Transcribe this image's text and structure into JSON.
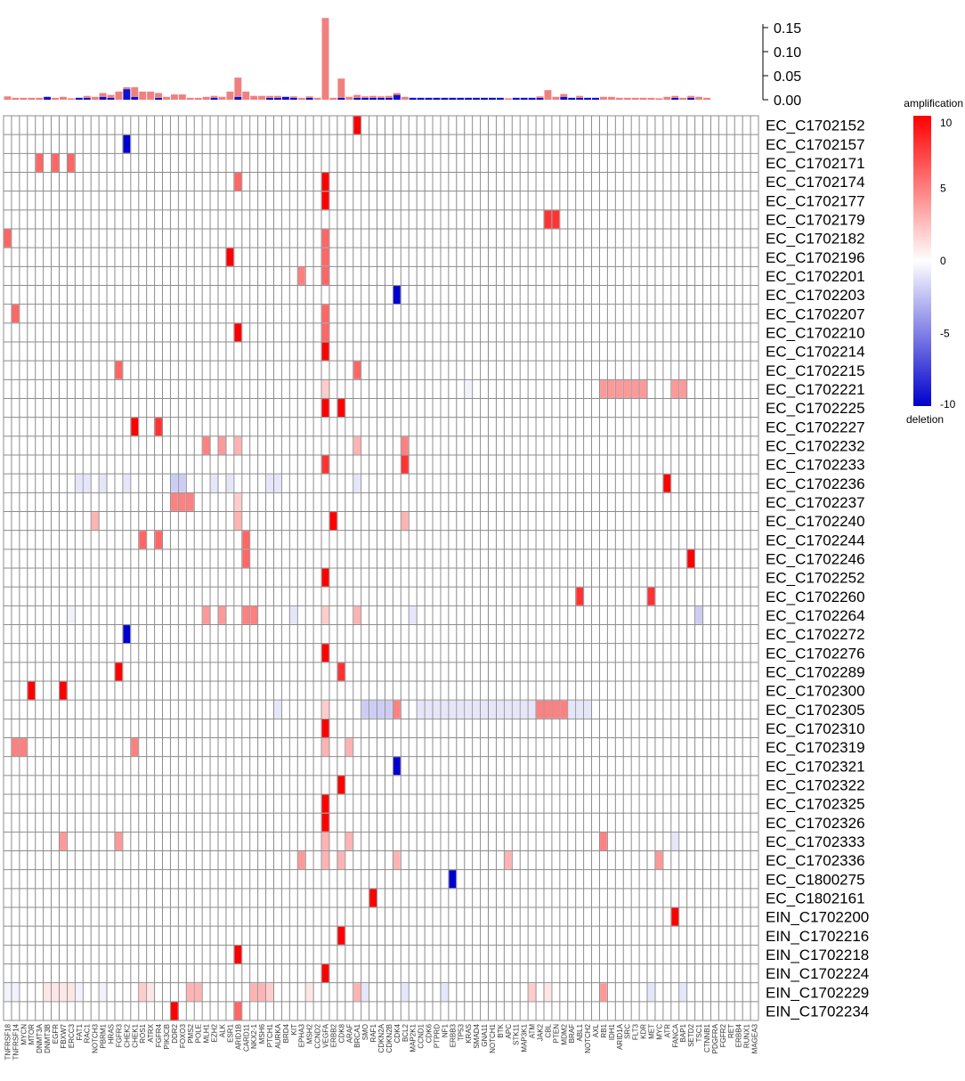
{
  "chart_data": {
    "type": "heatmap",
    "title": "",
    "colors": {
      "amplification": "#ff0000",
      "deletion": "#0000cc",
      "neutral": "#ffffff",
      "grid": "#8c8c8c",
      "bar_amplification": "#f08080",
      "bar_deletion": "#1010d0",
      "highlight_label": "#e53935"
    },
    "legend": {
      "top_label": "amplification",
      "bottom_label": "deletion",
      "placement": "top-right",
      "range": [
        -10,
        10
      ],
      "ticks": [
        "10",
        "5",
        "0",
        "-5",
        "-10"
      ]
    },
    "bar_axis": {
      "ylim": [
        0,
        0.2
      ],
      "ticks": [
        "0.15",
        "0.10",
        "0.05",
        "0.00"
      ]
    },
    "columns": [
      "TNFRSF18",
      "TNFRSF14",
      "MYCN",
      "MTOR",
      "DNMT3A",
      "DNMT3B",
      "EGFR",
      "FBXW7",
      "ERCC3",
      "FAT1",
      "RAC1",
      "NOTCH3",
      "PBRM1",
      "HRAS",
      "FGFR3",
      "CHEK2",
      "CHEK1",
      "ROS1",
      "ATRX",
      "FGFR4",
      "PIK3CB",
      "DDR2",
      "FOXO3",
      "PMS2",
      "POLE",
      "MLH1",
      "EZH2",
      "ALK",
      "ESR1",
      "ARID1B",
      "CARD11",
      "NKX2-1",
      "MSH6",
      "PTCH1",
      "AURKA",
      "BRD4",
      "KIT",
      "EPHA3",
      "MSH2",
      "CCND2",
      "VEGFA",
      "ERBB2",
      "CDK8",
      "ARAF",
      "BRCA1",
      "SMO",
      "RAF1",
      "CDKN2A",
      "CDKN2B",
      "CDK4",
      "BCL2",
      "MAP2K1",
      "CCND1",
      "CDK6",
      "PTPRD",
      "NF1",
      "ERBB3",
      "TP53",
      "KRAS",
      "SMAD4",
      "GNA11",
      "NOTCH1",
      "BTK",
      "APC",
      "STK11",
      "MAP3K1",
      "ATM",
      "JAK2",
      "CBL",
      "PTEN",
      "MDM2",
      "BRAF",
      "ABL1",
      "NOTCH2",
      "AXL",
      "RB1",
      "IDH1",
      "ARID1A",
      "SRC",
      "FLT3",
      "KDR",
      "MET",
      "MYC",
      "ATR",
      "FANCA",
      "BAP1",
      "SETD2",
      "TSC1",
      "CTNNB1",
      "PDGFRA",
      "FGFR2",
      "RET",
      "ERBB4",
      "RUNX1",
      "MAGEA3"
    ],
    "highlight_column": 40,
    "rows": [
      "EC_C1702152",
      "EC_C1702157",
      "EC_C1702171",
      "EC_C1702174",
      "EC_C1702177",
      "EC_C1702179",
      "EC_C1702182",
      "EC_C1702196",
      "EC_C1702201",
      "EC_C1702203",
      "EC_C1702207",
      "EC_C1702210",
      "EC_C1702214",
      "EC_C1702215",
      "EC_C1702221",
      "EC_C1702225",
      "EC_C1702227",
      "EC_C1702232",
      "EC_C1702233",
      "EC_C1702236",
      "EC_C1702237",
      "EC_C1702240",
      "EC_C1702244",
      "EC_C1702246",
      "EC_C1702252",
      "EC_C1702260",
      "EC_C1702264",
      "EC_C1702272",
      "EC_C1702276",
      "EC_C1702289",
      "EC_C1702300",
      "EC_C1702305",
      "EC_C1702310",
      "EC_C1702319",
      "EC_C1702321",
      "EC_C1702322",
      "EC_C1702325",
      "EC_C1702326",
      "EC_C1702333",
      "EC_C1702336",
      "EC_C1800275",
      "EC_C1802161",
      "EIN_C1702200",
      "EIN_C1702216",
      "EIN_C1702218",
      "EIN_C1702224",
      "EIN_C1702229",
      "EIN_C1702234"
    ],
    "cells": [
      [
        0,
        44,
        10
      ],
      [
        1,
        15,
        -10
      ],
      [
        2,
        4,
        6
      ],
      [
        2,
        6,
        6
      ],
      [
        2,
        8,
        6
      ],
      [
        3,
        29,
        6
      ],
      [
        3,
        40,
        10
      ],
      [
        4,
        40,
        10
      ],
      [
        5,
        68,
        8
      ],
      [
        5,
        69,
        8
      ],
      [
        6,
        0,
        6
      ],
      [
        6,
        40,
        6
      ],
      [
        7,
        28,
        10
      ],
      [
        7,
        40,
        6
      ],
      [
        8,
        37,
        5
      ],
      [
        8,
        40,
        6
      ],
      [
        9,
        49,
        -10
      ],
      [
        10,
        1,
        6
      ],
      [
        10,
        40,
        6
      ],
      [
        11,
        29,
        10
      ],
      [
        11,
        40,
        6
      ],
      [
        12,
        40,
        10
      ],
      [
        13,
        14,
        6
      ],
      [
        13,
        44,
        6
      ],
      [
        14,
        40,
        2
      ],
      [
        14,
        58,
        -0.5
      ],
      [
        14,
        75,
        4
      ],
      [
        14,
        76,
        4
      ],
      [
        14,
        77,
        4
      ],
      [
        14,
        78,
        4
      ],
      [
        14,
        79,
        4
      ],
      [
        14,
        80,
        4
      ],
      [
        14,
        84,
        4
      ],
      [
        14,
        85,
        4
      ],
      [
        15,
        40,
        10
      ],
      [
        15,
        42,
        10
      ],
      [
        16,
        16,
        10
      ],
      [
        16,
        19,
        8
      ],
      [
        17,
        25,
        5
      ],
      [
        17,
        27,
        4
      ],
      [
        17,
        29,
        3
      ],
      [
        17,
        44,
        3
      ],
      [
        17,
        50,
        5
      ],
      [
        18,
        40,
        8
      ],
      [
        18,
        50,
        8
      ],
      [
        19,
        9,
        -1
      ],
      [
        19,
        10,
        -1
      ],
      [
        19,
        12,
        -1
      ],
      [
        19,
        15,
        -1
      ],
      [
        19,
        21,
        -2
      ],
      [
        19,
        22,
        -2
      ],
      [
        19,
        26,
        -1
      ],
      [
        19,
        28,
        -1
      ],
      [
        19,
        33,
        -1
      ],
      [
        19,
        34,
        -1
      ],
      [
        19,
        44,
        -1
      ],
      [
        19,
        83,
        10
      ],
      [
        20,
        21,
        5
      ],
      [
        20,
        22,
        5
      ],
      [
        20,
        23,
        5
      ],
      [
        20,
        29,
        2
      ],
      [
        21,
        11,
        3
      ],
      [
        21,
        29,
        3
      ],
      [
        21,
        41,
        10
      ],
      [
        21,
        50,
        3
      ],
      [
        22,
        17,
        6
      ],
      [
        22,
        19,
        6
      ],
      [
        22,
        30,
        6
      ],
      [
        23,
        30,
        6
      ],
      [
        23,
        86,
        10
      ],
      [
        24,
        40,
        10
      ],
      [
        25,
        72,
        8
      ],
      [
        25,
        81,
        8
      ],
      [
        26,
        8,
        -0.5
      ],
      [
        26,
        25,
        4
      ],
      [
        26,
        27,
        4
      ],
      [
        26,
        30,
        5
      ],
      [
        26,
        31,
        5
      ],
      [
        26,
        36,
        -1
      ],
      [
        26,
        40,
        2
      ],
      [
        26,
        44,
        3
      ],
      [
        26,
        51,
        -1
      ],
      [
        26,
        87,
        -2
      ],
      [
        27,
        15,
        -10
      ],
      [
        28,
        40,
        10
      ],
      [
        29,
        14,
        10
      ],
      [
        29,
        42,
        8
      ],
      [
        30,
        3,
        10
      ],
      [
        30,
        7,
        10
      ],
      [
        31,
        34,
        -1
      ],
      [
        31,
        40,
        2
      ],
      [
        31,
        45,
        -2
      ],
      [
        31,
        46,
        -2
      ],
      [
        31,
        47,
        -2
      ],
      [
        31,
        48,
        -2
      ],
      [
        31,
        49,
        5
      ],
      [
        31,
        52,
        -1
      ],
      [
        31,
        53,
        -1
      ],
      [
        31,
        54,
        -1
      ],
      [
        31,
        55,
        -1
      ],
      [
        31,
        56,
        -1
      ],
      [
        31,
        57,
        -1
      ],
      [
        31,
        58,
        -1
      ],
      [
        31,
        59,
        -1
      ],
      [
        31,
        60,
        -1
      ],
      [
        31,
        61,
        -1
      ],
      [
        31,
        62,
        -1
      ],
      [
        31,
        63,
        -1
      ],
      [
        31,
        64,
        -1
      ],
      [
        31,
        65,
        -1
      ],
      [
        31,
        66,
        -1
      ],
      [
        31,
        67,
        5
      ],
      [
        31,
        68,
        5
      ],
      [
        31,
        69,
        5
      ],
      [
        31,
        70,
        5
      ],
      [
        31,
        71,
        -1
      ],
      [
        31,
        72,
        -1
      ],
      [
        31,
        73,
        -1
      ],
      [
        32,
        40,
        10
      ],
      [
        33,
        1,
        5
      ],
      [
        33,
        2,
        5
      ],
      [
        33,
        16,
        5
      ],
      [
        33,
        40,
        3
      ],
      [
        33,
        43,
        3
      ],
      [
        34,
        49,
        -10
      ],
      [
        35,
        42,
        10
      ],
      [
        36,
        40,
        10
      ],
      [
        37,
        40,
        10
      ],
      [
        38,
        7,
        4
      ],
      [
        38,
        14,
        4
      ],
      [
        38,
        40,
        3
      ],
      [
        38,
        43,
        3
      ],
      [
        38,
        75,
        5
      ],
      [
        38,
        84,
        -1
      ],
      [
        39,
        37,
        4
      ],
      [
        39,
        40,
        3
      ],
      [
        39,
        42,
        3
      ],
      [
        39,
        49,
        3
      ],
      [
        39,
        63,
        3
      ],
      [
        39,
        82,
        4
      ],
      [
        40,
        56,
        -10
      ],
      [
        41,
        46,
        10
      ],
      [
        42,
        84,
        10
      ],
      [
        43,
        42,
        10
      ],
      [
        44,
        29,
        10
      ],
      [
        45,
        40,
        10
      ],
      [
        46,
        0,
        -0.5
      ],
      [
        46,
        1,
        -0.5
      ],
      [
        46,
        5,
        1
      ],
      [
        46,
        6,
        1
      ],
      [
        46,
        7,
        1
      ],
      [
        46,
        8,
        1
      ],
      [
        46,
        9,
        -0.5
      ],
      [
        46,
        12,
        -0.5
      ],
      [
        46,
        17,
        2
      ],
      [
        46,
        18,
        1
      ],
      [
        46,
        23,
        3
      ],
      [
        46,
        24,
        3
      ],
      [
        46,
        31,
        3
      ],
      [
        46,
        32,
        3
      ],
      [
        46,
        33,
        2
      ],
      [
        46,
        38,
        1
      ],
      [
        46,
        44,
        3
      ],
      [
        46,
        45,
        -1
      ],
      [
        46,
        50,
        -1
      ],
      [
        46,
        55,
        -1
      ],
      [
        46,
        66,
        2
      ],
      [
        46,
        68,
        1
      ],
      [
        46,
        75,
        4
      ],
      [
        46,
        81,
        -1
      ],
      [
        46,
        85,
        -1
      ],
      [
        47,
        21,
        10
      ],
      [
        47,
        29,
        6
      ]
    ],
    "column_bars": [
      {
        "amp": 0.007,
        "del": 0.0
      },
      {
        "amp": 0.004,
        "del": 0.0
      },
      {
        "amp": 0.004,
        "del": 0.0
      },
      {
        "amp": 0.004,
        "del": 0.0
      },
      {
        "amp": 0.004,
        "del": 0.0
      },
      {
        "amp": 0.0,
        "del": 0.006
      },
      {
        "amp": 0.004,
        "del": 0.0
      },
      {
        "amp": 0.006,
        "del": 0.0
      },
      {
        "amp": 0.003,
        "del": 0.0
      },
      {
        "amp": 0.0,
        "del": 0.004
      },
      {
        "amp": 0.004,
        "del": 0.004
      },
      {
        "amp": 0.006,
        "del": 0.0
      },
      {
        "amp": 0.008,
        "del": 0.006
      },
      {
        "amp": 0.006,
        "del": 0.004
      },
      {
        "amp": 0.017,
        "del": 0.0
      },
      {
        "amp": 0.004,
        "del": 0.022
      },
      {
        "amp": 0.02,
        "del": 0.006
      },
      {
        "amp": 0.017,
        "del": 0.0
      },
      {
        "amp": 0.017,
        "del": 0.0
      },
      {
        "amp": 0.01,
        "del": 0.004
      },
      {
        "amp": 0.006,
        "del": 0.0
      },
      {
        "amp": 0.011,
        "del": 0.0
      },
      {
        "amp": 0.011,
        "del": 0.0
      },
      {
        "amp": 0.004,
        "del": 0.0
      },
      {
        "amp": 0.004,
        "del": 0.0
      },
      {
        "amp": 0.006,
        "del": 0.0
      },
      {
        "amp": 0.004,
        "del": 0.004
      },
      {
        "amp": 0.006,
        "del": 0.0
      },
      {
        "amp": 0.017,
        "del": 0.0
      },
      {
        "amp": 0.04,
        "del": 0.006
      },
      {
        "amp": 0.017,
        "del": 0.0
      },
      {
        "amp": 0.008,
        "del": 0.0
      },
      {
        "amp": 0.008,
        "del": 0.0
      },
      {
        "amp": 0.004,
        "del": 0.004
      },
      {
        "amp": 0.004,
        "del": 0.004
      },
      {
        "amp": 0.0,
        "del": 0.006
      },
      {
        "amp": 0.003,
        "del": 0.004
      },
      {
        "amp": 0.004,
        "del": 0.0
      },
      {
        "amp": 0.003,
        "del": 0.004
      },
      {
        "amp": 0.004,
        "del": 0.0
      },
      {
        "amp": 0.17,
        "del": 0.0
      },
      {
        "amp": 0.004,
        "del": 0.0
      },
      {
        "amp": 0.04,
        "del": 0.004
      },
      {
        "amp": 0.006,
        "del": 0.0
      },
      {
        "amp": 0.006,
        "del": 0.004
      },
      {
        "amp": 0.003,
        "del": 0.004
      },
      {
        "amp": 0.004,
        "del": 0.004
      },
      {
        "amp": 0.003,
        "del": 0.004
      },
      {
        "amp": 0.004,
        "del": 0.004
      },
      {
        "amp": 0.004,
        "del": 0.01
      },
      {
        "amp": 0.006,
        "del": 0.0
      },
      {
        "amp": 0.0,
        "del": 0.004
      },
      {
        "amp": 0.0,
        "del": 0.004
      },
      {
        "amp": 0.0,
        "del": 0.004
      },
      {
        "amp": 0.0,
        "del": 0.004
      },
      {
        "amp": 0.0,
        "del": 0.004
      },
      {
        "amp": 0.0,
        "del": 0.004
      },
      {
        "amp": 0.0,
        "del": 0.004
      },
      {
        "amp": 0.0,
        "del": 0.004
      },
      {
        "amp": 0.0,
        "del": 0.004
      },
      {
        "amp": 0.0,
        "del": 0.004
      },
      {
        "amp": 0.0,
        "del": 0.004
      },
      {
        "amp": 0.0,
        "del": 0.004
      },
      {
        "amp": 0.003,
        "del": 0.0
      },
      {
        "amp": 0.0,
        "del": 0.004
      },
      {
        "amp": 0.0,
        "del": 0.004
      },
      {
        "amp": 0.0,
        "del": 0.004
      },
      {
        "amp": 0.003,
        "del": 0.004
      },
      {
        "amp": 0.02,
        "del": 0.0
      },
      {
        "amp": 0.006,
        "del": 0.0
      },
      {
        "amp": 0.006,
        "del": 0.006
      },
      {
        "amp": 0.0,
        "del": 0.004
      },
      {
        "amp": 0.004,
        "del": 0.004
      },
      {
        "amp": 0.0,
        "del": 0.004
      },
      {
        "amp": 0.0,
        "del": 0.004
      },
      {
        "amp": 0.006,
        "del": 0.0
      },
      {
        "amp": 0.006,
        "del": 0.0
      },
      {
        "amp": 0.004,
        "del": 0.0
      },
      {
        "amp": 0.004,
        "del": 0.0
      },
      {
        "amp": 0.004,
        "del": 0.0
      },
      {
        "amp": 0.004,
        "del": 0.0
      },
      {
        "amp": 0.004,
        "del": 0.0
      },
      {
        "amp": 0.003,
        "del": 0.0
      },
      {
        "amp": 0.006,
        "del": 0.0
      },
      {
        "amp": 0.004,
        "del": 0.004
      },
      {
        "amp": 0.004,
        "del": 0.0
      },
      {
        "amp": 0.004,
        "del": 0.004
      },
      {
        "amp": 0.006,
        "del": 0.0
      },
      {
        "amp": 0.004,
        "del": 0.0
      }
    ]
  }
}
